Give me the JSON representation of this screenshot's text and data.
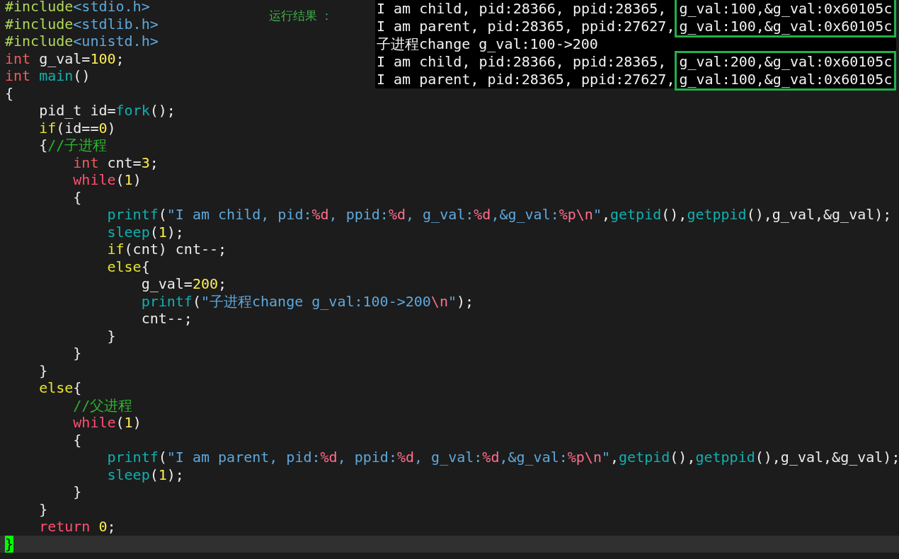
{
  "editor": {
    "lines": [
      {
        "current": false,
        "tokens": [
          {
            "kind": "preproc",
            "text": "#include"
          },
          {
            "kind": "header",
            "text": "<stdio.h>"
          }
        ]
      },
      {
        "current": false,
        "tokens": [
          {
            "kind": "preproc",
            "text": "#include"
          },
          {
            "kind": "header",
            "text": "<stdlib.h>"
          }
        ]
      },
      {
        "current": false,
        "tokens": [
          {
            "kind": "preproc",
            "text": "#include"
          },
          {
            "kind": "header",
            "text": "<unistd.h>"
          }
        ]
      },
      {
        "current": false,
        "tokens": [
          {
            "kind": "type",
            "text": "int"
          },
          {
            "kind": "plain",
            "text": " g_val="
          },
          {
            "kind": "number",
            "text": "100"
          },
          {
            "kind": "plain",
            "text": ";"
          }
        ]
      },
      {
        "current": false,
        "tokens": [
          {
            "kind": "type",
            "text": "int "
          },
          {
            "kind": "func",
            "text": "main"
          },
          {
            "kind": "plain",
            "text": "()"
          }
        ]
      },
      {
        "current": false,
        "tokens": [
          {
            "kind": "plain",
            "text": "{"
          }
        ]
      },
      {
        "current": false,
        "tokens": [
          {
            "kind": "plain",
            "text": "    pid_t id="
          },
          {
            "kind": "func",
            "text": "fork"
          },
          {
            "kind": "plain",
            "text": "();"
          }
        ]
      },
      {
        "current": false,
        "tokens": [
          {
            "kind": "keyword",
            "text": "    if"
          },
          {
            "kind": "plain",
            "text": "(id=="
          },
          {
            "kind": "number",
            "text": "0"
          },
          {
            "kind": "plain",
            "text": ")"
          }
        ]
      },
      {
        "current": false,
        "tokens": [
          {
            "kind": "plain",
            "text": "    {"
          },
          {
            "kind": "comment",
            "text": "//子进程"
          }
        ]
      },
      {
        "current": false,
        "tokens": [
          {
            "kind": "type",
            "text": "        int"
          },
          {
            "kind": "plain",
            "text": " cnt="
          },
          {
            "kind": "number",
            "text": "3"
          },
          {
            "kind": "plain",
            "text": ";"
          }
        ]
      },
      {
        "current": false,
        "tokens": [
          {
            "kind": "statement",
            "text": "        while"
          },
          {
            "kind": "plain",
            "text": "("
          },
          {
            "kind": "number",
            "text": "1"
          },
          {
            "kind": "plain",
            "text": ")"
          }
        ]
      },
      {
        "current": false,
        "tokens": [
          {
            "kind": "plain",
            "text": "        {"
          }
        ]
      },
      {
        "current": false,
        "tokens": [
          {
            "kind": "func",
            "text": "            printf"
          },
          {
            "kind": "plain",
            "text": "("
          },
          {
            "kind": "string",
            "text": "\"I am child, pid:"
          },
          {
            "kind": "format",
            "text": "%d"
          },
          {
            "kind": "string",
            "text": ", ppid:"
          },
          {
            "kind": "format",
            "text": "%d"
          },
          {
            "kind": "string",
            "text": ", g_val:"
          },
          {
            "kind": "format",
            "text": "%d"
          },
          {
            "kind": "string",
            "text": ",&g_val:"
          },
          {
            "kind": "format",
            "text": "%p\\n"
          },
          {
            "kind": "string",
            "text": "\""
          },
          {
            "kind": "plain",
            "text": ","
          },
          {
            "kind": "func",
            "text": "getpid"
          },
          {
            "kind": "plain",
            "text": "(),"
          },
          {
            "kind": "func",
            "text": "getppid"
          },
          {
            "kind": "plain",
            "text": "(),g_val,&g_val);"
          }
        ]
      },
      {
        "current": false,
        "tokens": [
          {
            "kind": "func",
            "text": "            sleep"
          },
          {
            "kind": "plain",
            "text": "("
          },
          {
            "kind": "number",
            "text": "1"
          },
          {
            "kind": "plain",
            "text": ");"
          }
        ]
      },
      {
        "current": false,
        "tokens": [
          {
            "kind": "keyword",
            "text": "            if"
          },
          {
            "kind": "plain",
            "text": "(cnt) cnt--;"
          }
        ]
      },
      {
        "current": false,
        "tokens": [
          {
            "kind": "keyword",
            "text": "            else"
          },
          {
            "kind": "plain",
            "text": "{"
          }
        ]
      },
      {
        "current": false,
        "tokens": [
          {
            "kind": "plain",
            "text": "                g_val="
          },
          {
            "kind": "number",
            "text": "200"
          },
          {
            "kind": "plain",
            "text": ";"
          }
        ]
      },
      {
        "current": false,
        "tokens": [
          {
            "kind": "func",
            "text": "                printf"
          },
          {
            "kind": "plain",
            "text": "("
          },
          {
            "kind": "string",
            "text": "\"子进程change g_val:100->200"
          },
          {
            "kind": "format",
            "text": "\\n"
          },
          {
            "kind": "string",
            "text": "\""
          },
          {
            "kind": "plain",
            "text": ");"
          }
        ]
      },
      {
        "current": false,
        "tokens": [
          {
            "kind": "plain",
            "text": "                cnt--;"
          }
        ]
      },
      {
        "current": false,
        "tokens": [
          {
            "kind": "plain",
            "text": "            }"
          }
        ]
      },
      {
        "current": false,
        "tokens": [
          {
            "kind": "plain",
            "text": "        }"
          }
        ]
      },
      {
        "current": false,
        "tokens": [
          {
            "kind": "plain",
            "text": "    }"
          }
        ]
      },
      {
        "current": false,
        "tokens": [
          {
            "kind": "keyword",
            "text": "    else"
          },
          {
            "kind": "plain",
            "text": "{"
          }
        ]
      },
      {
        "current": false,
        "tokens": [
          {
            "kind": "comment",
            "text": "        //父进程"
          }
        ]
      },
      {
        "current": false,
        "tokens": [
          {
            "kind": "statement",
            "text": "        while"
          },
          {
            "kind": "plain",
            "text": "("
          },
          {
            "kind": "number",
            "text": "1"
          },
          {
            "kind": "plain",
            "text": ")"
          }
        ]
      },
      {
        "current": false,
        "tokens": [
          {
            "kind": "plain",
            "text": "        {"
          }
        ]
      },
      {
        "current": false,
        "tokens": [
          {
            "kind": "func",
            "text": "            printf"
          },
          {
            "kind": "plain",
            "text": "("
          },
          {
            "kind": "string",
            "text": "\"I am parent, pid:"
          },
          {
            "kind": "format",
            "text": "%d"
          },
          {
            "kind": "string",
            "text": ", ppid:"
          },
          {
            "kind": "format",
            "text": "%d"
          },
          {
            "kind": "string",
            "text": ", g_val:"
          },
          {
            "kind": "format",
            "text": "%d"
          },
          {
            "kind": "string",
            "text": ",&g_val:"
          },
          {
            "kind": "format",
            "text": "%p\\n"
          },
          {
            "kind": "string",
            "text": "\""
          },
          {
            "kind": "plain",
            "text": ","
          },
          {
            "kind": "func",
            "text": "getpid"
          },
          {
            "kind": "plain",
            "text": "(),"
          },
          {
            "kind": "func",
            "text": "getppid"
          },
          {
            "kind": "plain",
            "text": "(),g_val,&g_val);"
          }
        ]
      },
      {
        "current": false,
        "tokens": [
          {
            "kind": "func",
            "text": "            sleep"
          },
          {
            "kind": "plain",
            "text": "("
          },
          {
            "kind": "number",
            "text": "1"
          },
          {
            "kind": "plain",
            "text": ");"
          }
        ]
      },
      {
        "current": false,
        "tokens": [
          {
            "kind": "plain",
            "text": "        }"
          }
        ]
      },
      {
        "current": false,
        "tokens": [
          {
            "kind": "plain",
            "text": "    }"
          }
        ]
      },
      {
        "current": false,
        "tokens": [
          {
            "kind": "statement",
            "text": "    return "
          },
          {
            "kind": "number",
            "text": "0"
          },
          {
            "kind": "plain",
            "text": ";"
          }
        ]
      },
      {
        "current": true,
        "tokens": [
          {
            "kind": "cursor",
            "text": "}"
          }
        ]
      }
    ]
  },
  "output_label": "运行结果 ：",
  "output": {
    "blocks": [
      {
        "kind": "highlighted",
        "lines": [
          {
            "head": "I am child, pid:28366, ppid:28365,",
            "tail": "g_val:100,&g_val:0x60105c"
          },
          {
            "head": "I am parent, pid:28365, ppid:27627,",
            "tail": "g_val:100,&g_val:0x60105c"
          }
        ]
      },
      {
        "kind": "plain",
        "lines": [
          {
            "head": "子进程change g_val:100->200"
          }
        ]
      },
      {
        "kind": "highlighted",
        "lines": [
          {
            "head": "I am child, pid:28366, ppid:28365,",
            "tail": "g_val:200,&g_val:0x60105c"
          },
          {
            "head": "I am parent, pid:28365, ppid:27627,",
            "tail": "g_val:100,&g_val:0x60105c"
          }
        ]
      }
    ]
  }
}
